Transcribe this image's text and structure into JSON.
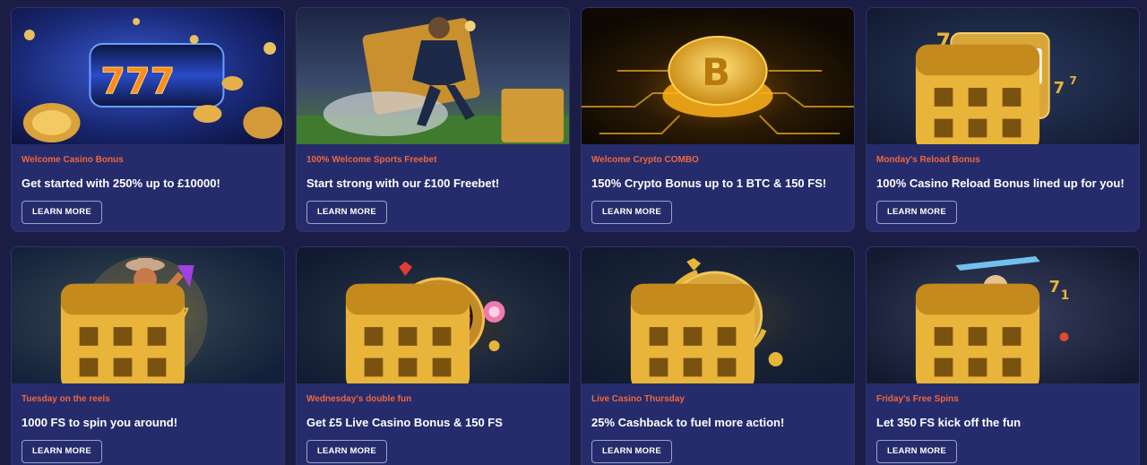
{
  "colors": {
    "page_bg": "#1b1d45",
    "card_bg": "#262c6b",
    "category_text": "#f0663d",
    "accent_gold": "#e8b43a"
  },
  "promos": [
    {
      "category": "Welcome Casino Bonus",
      "headline": "Get started with 250% up to £10000!",
      "button": "LEARN MORE",
      "art_icon": "slot-reel-777-icon"
    },
    {
      "category": "100% Welcome Sports Freebet",
      "headline": "Start strong with our £100 Freebet!",
      "button": "LEARN MORE",
      "art_icon": "football-player-ticket-icon"
    },
    {
      "category": "Welcome Crypto COMBO",
      "headline": "150% Crypto Bonus up to 1 BTC & 150 FS!",
      "button": "LEARN MORE",
      "art_icon": "bitcoin-coin-icon"
    },
    {
      "category": "Monday's Reload Bonus",
      "headline": "100% Casino Reload Bonus lined up for you!",
      "button": "LEARN MORE",
      "art_icon": "slot-machine-icon"
    },
    {
      "category": "Tuesday on the reels",
      "headline": "1000 FS to spin you around!",
      "button": "LEARN MORE",
      "art_icon": "cowboy-character-icon"
    },
    {
      "category": "Wednesday's double fun",
      "headline": "Get £5 Live Casino Bonus & 150 FS",
      "button": "LEARN MORE",
      "art_icon": "roulette-wheel-icon"
    },
    {
      "category": "Live Casino Thursday",
      "headline": "25% Cashback to fuel more action!",
      "button": "LEARN MORE",
      "art_icon": "spade-chip-icon"
    },
    {
      "category": "Friday's Free Spins",
      "headline": "Let 350 FS kick off the fun",
      "button": "LEARN MORE",
      "art_icon": "zeus-character-icon"
    }
  ]
}
